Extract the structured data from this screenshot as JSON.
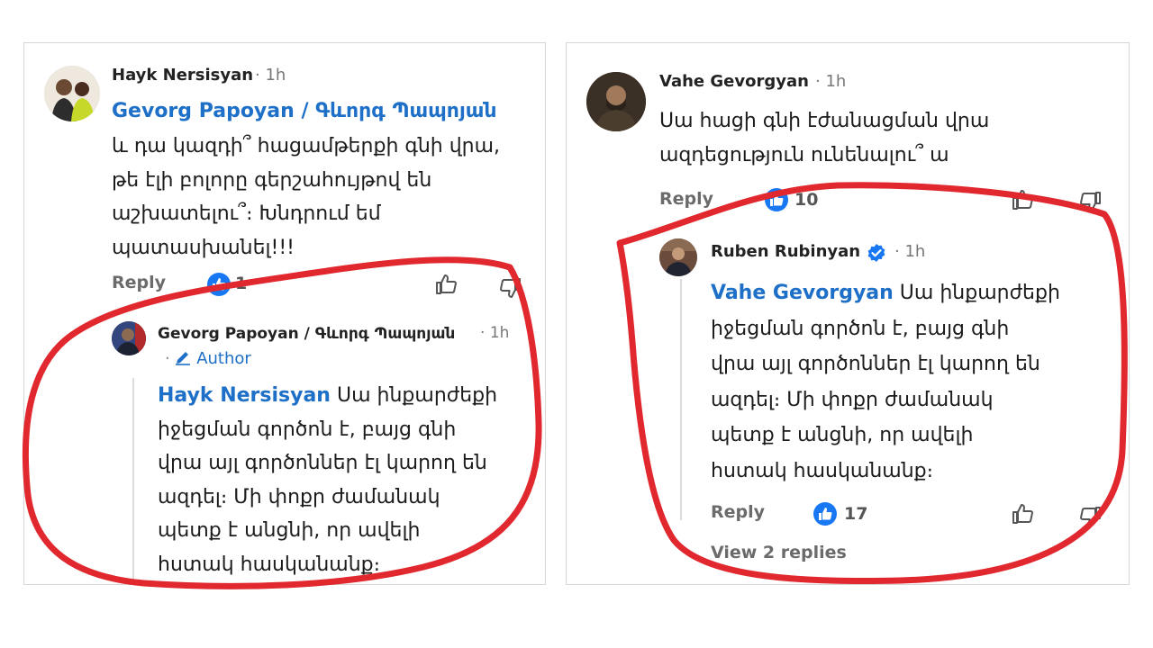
{
  "left_panel": {
    "comment": {
      "author": "Hayk  Nersisyan",
      "time": "1h",
      "mention": "Gevorg Papoyan / Գևորգ Պապոյան",
      "lines": [
        "և դա կազդի՞ հացամթերքի գնի վրա,",
        "թե էլի բոլորը գերշահույթով են",
        "աշխատելու՞։ Խնդրում եմ",
        "պատասխանել!!!"
      ],
      "reply_label": "Reply",
      "likes": "1"
    },
    "reply": {
      "author": "Gevorg Papoyan / Գևորգ Պապոյան",
      "time": "1h",
      "badge": "Author",
      "mention": "Hayk  Nersisyan",
      "first_line_rest": " Սա ինքարժեքի",
      "lines": [
        "իջեցման գործոն է, բայց գնի",
        "վրա այլ գործոններ էլ կարող են",
        "ազդել։ Մի փոքր ժամանակ",
        "պետք է անցնի, որ ավելի",
        "հստակ հասկանանք։"
      ]
    }
  },
  "right_panel": {
    "comment": {
      "author": "Vahe Gevorgyan",
      "time": "1h",
      "lines": [
        "Սա հացի գնի էժանացման վրա",
        "ազդեցություն ունենալու՞ ա"
      ],
      "reply_label": "Reply",
      "likes": "10"
    },
    "reply": {
      "author": "Ruben Rubinyan",
      "time": "1h",
      "mention": "Vahe Gevorgyan",
      "first_line_rest": " Սա ինքարժեքի",
      "lines": [
        "իջեցման գործոն է, բայց գնի",
        "վրա այլ գործոններ էլ կարող են",
        "ազդել։ Մի փոքր ժամանակ",
        "պետք է անցնի, որ ավելի",
        "հստակ հասկանանք։"
      ],
      "reply_label": "Reply",
      "likes": "17",
      "view_replies": "View 2 replies"
    }
  },
  "colors": {
    "mention": "#1d6fc7",
    "like_badge": "#1877f2",
    "verified": "#1877f2",
    "annotation": "#e0282e"
  },
  "icons": [
    "like-badge-icon",
    "thumbs-up-icon",
    "thumbs-down-icon",
    "verified-icon",
    "pencil-icon"
  ]
}
